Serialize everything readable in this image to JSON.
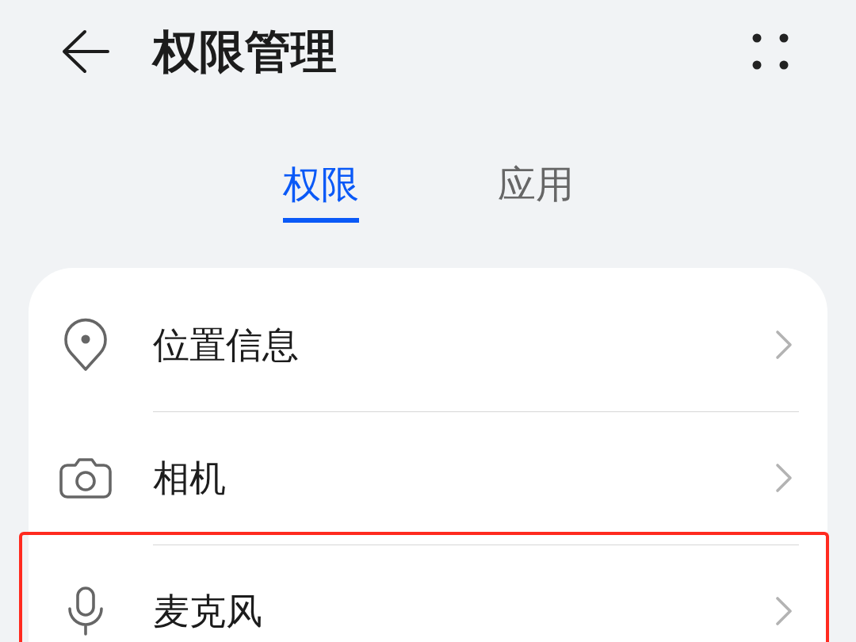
{
  "header": {
    "title": "权限管理"
  },
  "tabs": [
    {
      "label": "权限",
      "selected": true
    },
    {
      "label": "应用",
      "selected": false
    }
  ],
  "permissions": [
    {
      "label": "位置信息",
      "highlighted": false
    },
    {
      "label": "相机",
      "highlighted": false
    },
    {
      "label": "麦克风",
      "highlighted": true
    }
  ]
}
